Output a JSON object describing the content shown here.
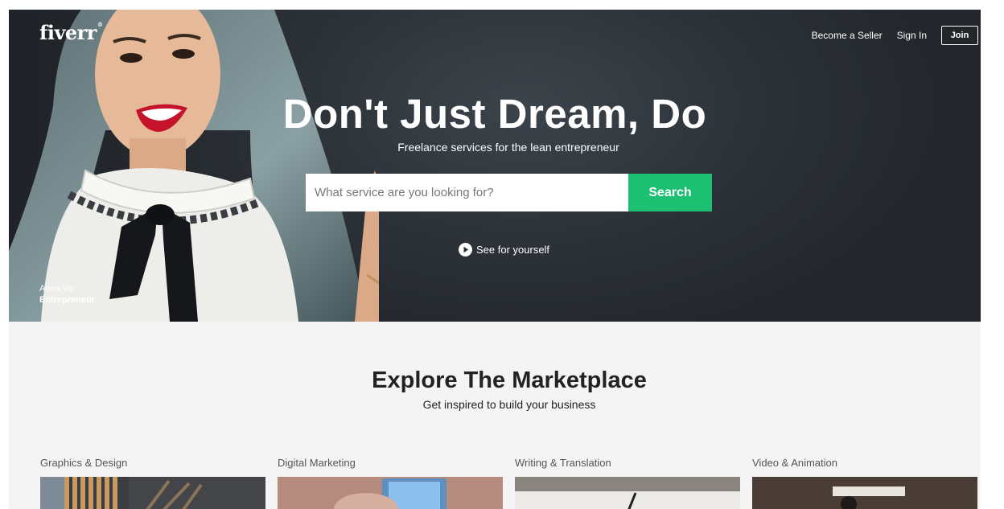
{
  "header": {
    "logo": "fiverr",
    "nav": {
      "become_seller": "Become a Seller",
      "sign_in": "Sign In",
      "join": "Join"
    }
  },
  "hero": {
    "headline": "Don't Just Dream, Do",
    "subheadline": "Freelance services for the lean entrepreneur",
    "search": {
      "placeholder": "What service are you looking for?",
      "value": "",
      "button": "Search"
    },
    "video_link": "See for yourself",
    "credit": {
      "name": "Anna Vo",
      "role": "Entrepreneur"
    }
  },
  "explore": {
    "title": "Explore The Marketplace",
    "subtitle": "Get inspired to build your business",
    "categories": [
      {
        "label": "Graphics & Design"
      },
      {
        "label": "Digital Marketing"
      },
      {
        "label": "Writing & Translation"
      },
      {
        "label": "Video & Animation"
      }
    ]
  },
  "colors": {
    "accent": "#1dbf73",
    "hero_bg": "#2c3238",
    "page_bg": "#f4f4f4"
  }
}
